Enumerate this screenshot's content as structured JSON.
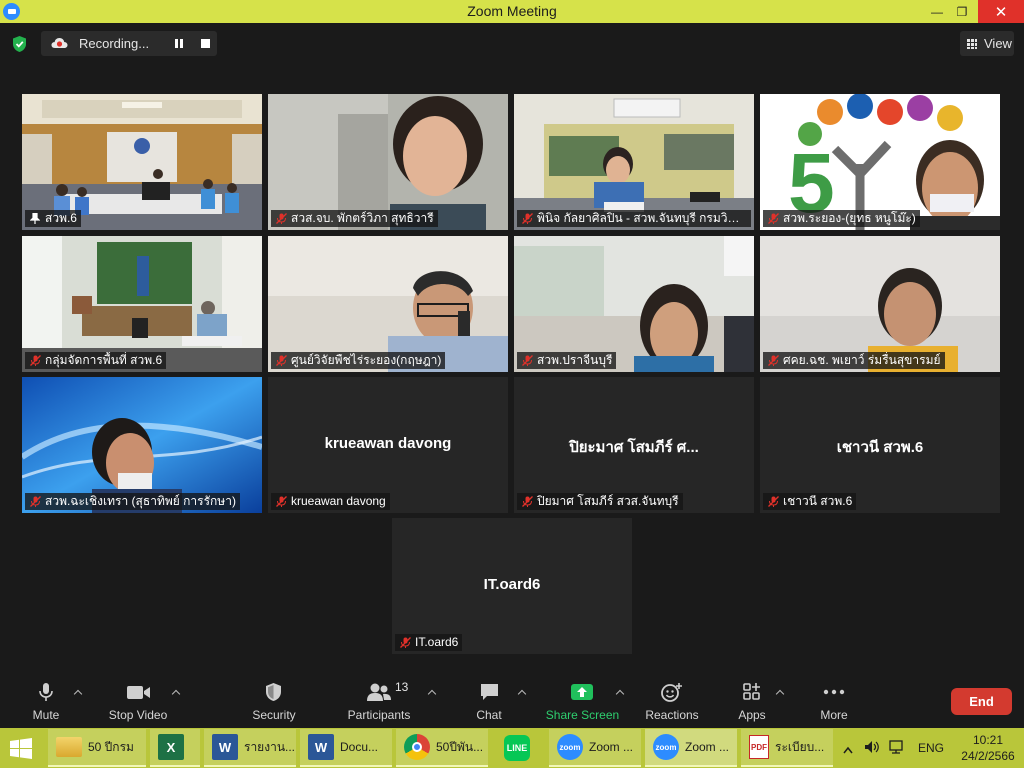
{
  "window": {
    "title": "Zoom Meeting",
    "minimize_glyph": "—",
    "maximize_glyph": "❐",
    "close_glyph": "✕"
  },
  "topbar": {
    "recording_label": "Recording...",
    "view_label": "View"
  },
  "participants": [
    {
      "display": "",
      "name": "สวพ.6",
      "muted": false,
      "pinned": true,
      "active": true,
      "scene": "conference-room"
    },
    {
      "display": "",
      "name": "สวส.จบ. พักตร์วิภา สุทธิวารี",
      "muted": true,
      "scene": "woman-blur"
    },
    {
      "display": "",
      "name": "พินิจ กัลยาศิลปิน - สวพ.จันทบุรี กรมวิชา...",
      "muted": true,
      "scene": "poster-room"
    },
    {
      "display": "",
      "name": "สวพ.ระยอง-(ยุทธ หนูโม๊ะ)",
      "muted": true,
      "scene": "logo-50"
    },
    {
      "display": "",
      "name": "กลุ่มจัดการพื้นที่ สวพ.6",
      "muted": true,
      "scene": "office-table"
    },
    {
      "display": "",
      "name": "ศูนย์วิจัยพืชไร่ระยอง(กฤษฎา)",
      "muted": true,
      "scene": "man-phone"
    },
    {
      "display": "",
      "name": "สวพ.ปราจีนบุรี",
      "muted": true,
      "scene": "woman-office"
    },
    {
      "display": "",
      "name": "ศคย.ฉช. พเยาว์ ร่มรื่นสุขารมย์",
      "muted": true,
      "scene": "woman-white"
    },
    {
      "display": "",
      "name": "สวพ.ฉะเชิงเทรา (สุธาทิพย์ การรักษา)",
      "muted": true,
      "scene": "woman-blue"
    },
    {
      "display": "krueawan davong",
      "name": "krueawan davong",
      "muted": true,
      "scene": "none"
    },
    {
      "display": "ปิยะมาศ โสมภีร์ ศ...",
      "name": "ปิยมาศ โสมภีร์ สวส.จันทบุรี",
      "muted": true,
      "scene": "none"
    },
    {
      "display": "เชาวนี สวพ.6",
      "name": "เชาวนี สวพ.6",
      "muted": true,
      "scene": "none"
    },
    {
      "display": "IT.oard6",
      "name": "IT.oard6",
      "muted": true,
      "scene": "none"
    }
  ],
  "toolbar": {
    "mute": "Mute",
    "stop_video": "Stop Video",
    "security": "Security",
    "participants": "Participants",
    "participants_count": "13",
    "chat": "Chat",
    "share_screen": "Share Screen",
    "reactions": "Reactions",
    "apps": "Apps",
    "more": "More",
    "end": "End"
  },
  "taskbar": {
    "items": [
      {
        "label": "50 ปีกรม",
        "icon": "folder-icon"
      },
      {
        "label": "",
        "icon": "excel-icon"
      },
      {
        "label": "รายงาน...",
        "icon": "word-icon"
      },
      {
        "label": "Docu...",
        "icon": "word-icon"
      },
      {
        "label": "50ปีพัน...",
        "icon": "chrome-icon"
      },
      {
        "label": "",
        "icon": "line-icon"
      },
      {
        "label": "Zoom ...",
        "icon": "zoom-icon"
      },
      {
        "label": "Zoom ...",
        "icon": "zoom-icon"
      },
      {
        "label": "ระเบียบ...",
        "icon": "pdf-icon"
      }
    ],
    "language": "ENG",
    "time": "10:21",
    "date": "24/2/2566"
  },
  "colors": {
    "titlebar": "#d6e24a",
    "taskbar": "#b9c63a",
    "end": "#d33a2f",
    "share": "#2ecf6f",
    "active_border": "#d7e24c"
  }
}
